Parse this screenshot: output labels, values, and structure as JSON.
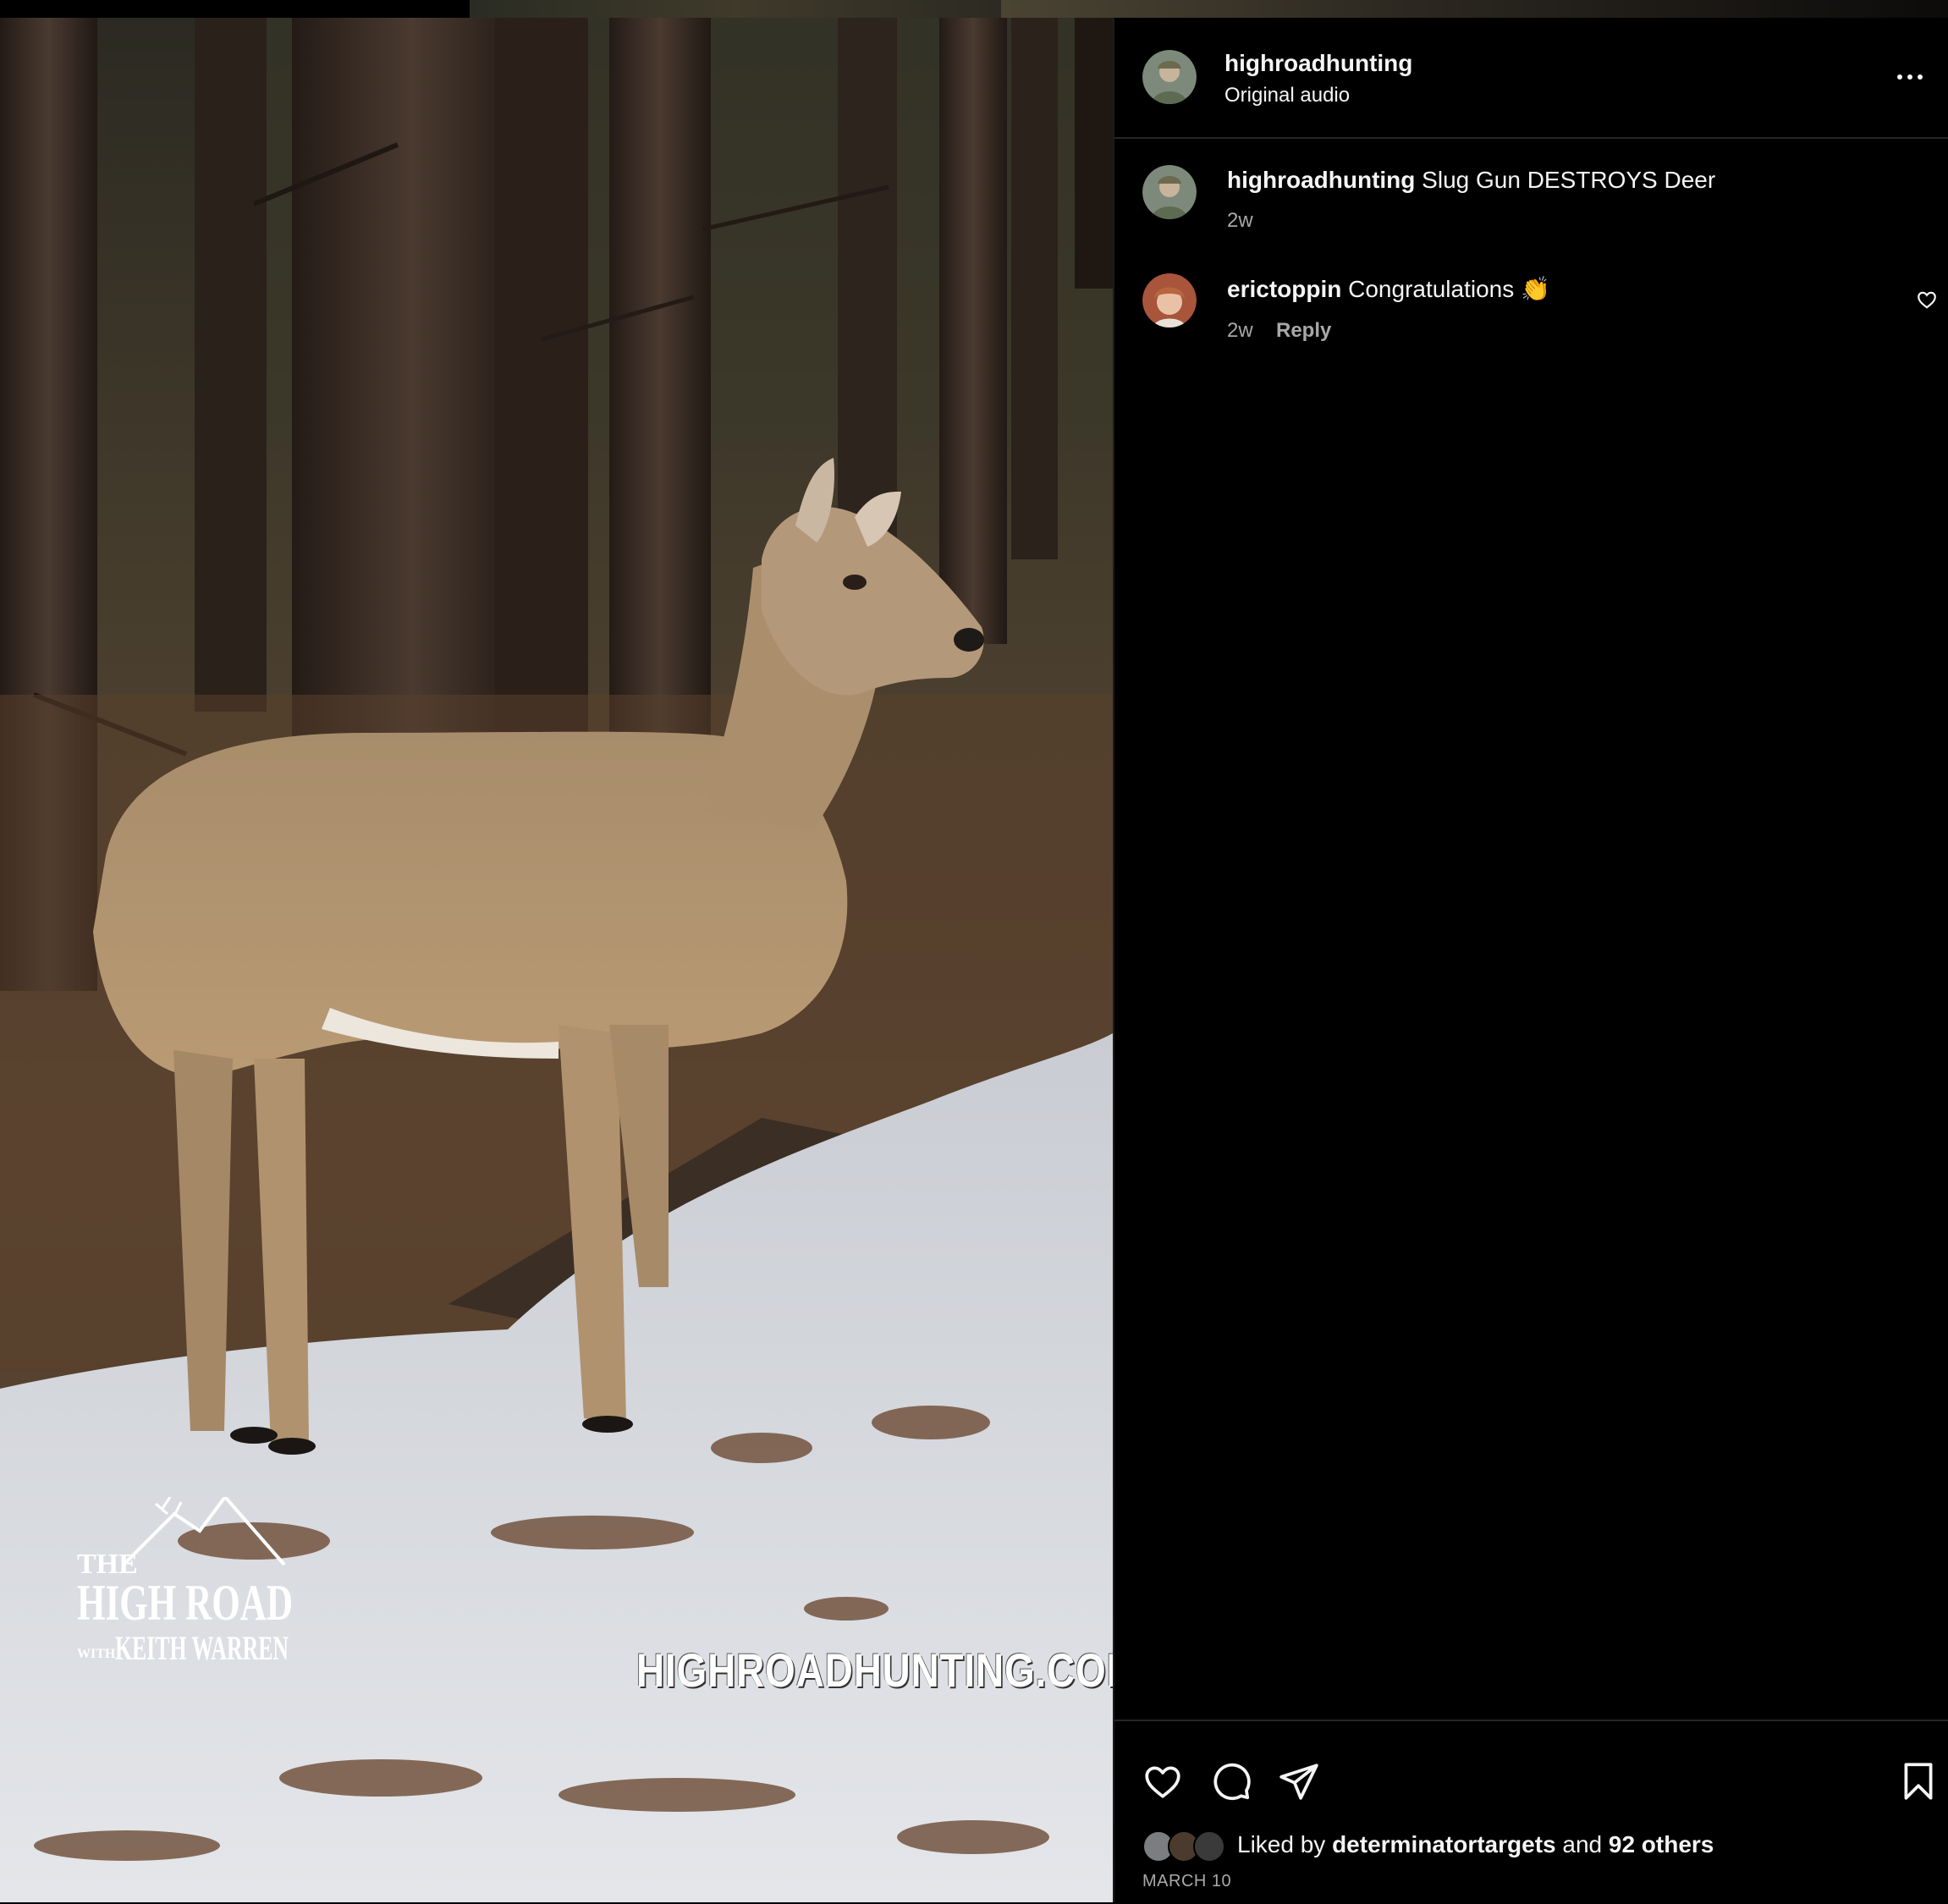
{
  "post": {
    "username": "highroadhunting",
    "audio": "Original audio",
    "caption": {
      "username": "highroadhunting",
      "text": "Slug Gun DESTROYS Deer",
      "time": "2w"
    },
    "comments": [
      {
        "username": "erictoppin",
        "text": "Congratulations 👏",
        "time": "2w",
        "reply_label": "Reply"
      }
    ],
    "likes": {
      "prefix": "Liked by",
      "user": "determinatortargets",
      "joiner": "and",
      "others": "92 others"
    },
    "date": "MARCH 10"
  },
  "media": {
    "watermark_text": "HIGHROADHUNTING.COM",
    "logo": {
      "line1": "THE",
      "line2": "HIGH ROAD",
      "line3_prefix": "WITH",
      "line3": "KEITH WARREN"
    }
  },
  "icons": {
    "more": "more-options-icon",
    "like": "heart-icon",
    "comment": "comment-icon",
    "share": "share-icon",
    "save": "bookmark-icon",
    "comment_like": "small-heart-icon"
  }
}
